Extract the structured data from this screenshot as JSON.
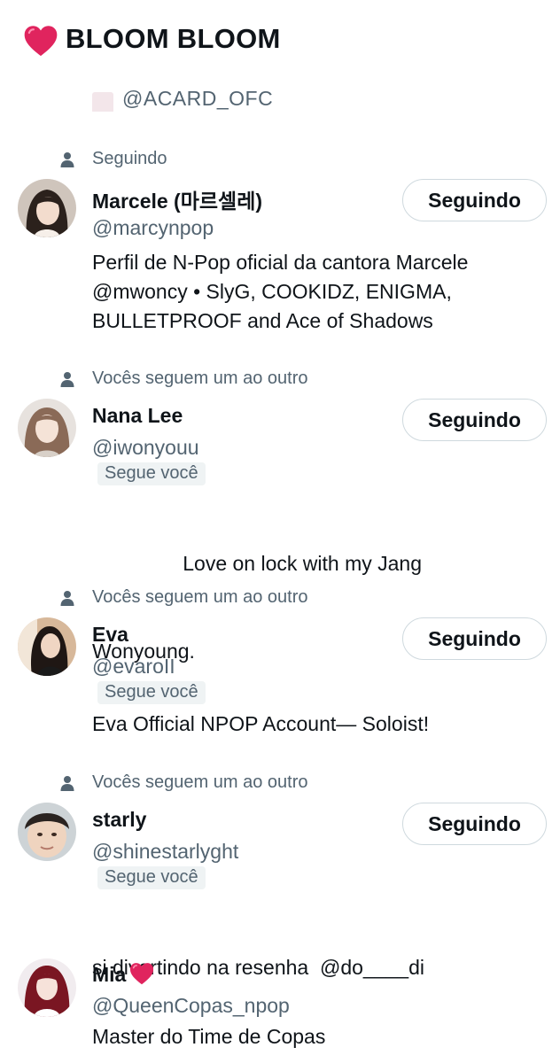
{
  "header": {
    "title": "BLOOM BLOOM",
    "icon": "heart-icon",
    "heart_color": "#e0245e"
  },
  "partial_row": {
    "handle_text": "@ACARD_OFC"
  },
  "colors": {
    "text": "#0f1419",
    "secondary": "#536471",
    "border": "#cfd9de",
    "badge_bg": "#eff3f4"
  },
  "users": [
    {
      "context": "Seguindo",
      "name": "Marcele (마르셀레)",
      "handle": "@marcynpop",
      "follows_you": "",
      "bio": [
        "Perfil de N-Pop oficial da cantora Marcele",
        "@mwoncy • SlyG, COOKIDZ, ENIGMA,",
        "BULLETPROOF and Ace of Shadows"
      ],
      "button": "Seguindo"
    },
    {
      "context": "Vocês seguem um ao outro",
      "name": "Nana Lee",
      "handle": "@iwonyouu",
      "follows_you": "Segue você",
      "bio": [
        "                Love on lock with my Jang",
        "Wonyoung."
      ],
      "button": "Seguindo"
    },
    {
      "context": "Vocês seguem um ao outro",
      "name": "Eva",
      "handle": "@evaroII",
      "follows_you": "Segue você",
      "bio": [
        "Eva Official NPOP Account— Soloist!"
      ],
      "button": "Seguindo"
    },
    {
      "context": "Vocês seguem um ao outro",
      "name": "starly",
      "handle": "@shinestarlyght",
      "follows_you": "Segue você",
      "bio": [
        "si divertindo na resenha  @do____di"
      ],
      "button": "Seguindo"
    },
    {
      "context": "",
      "name": "Mia",
      "handle": "@QueenCopas_npop",
      "follows_you": "",
      "bio": [
        "Master do Time de Copas"
      ],
      "button": ""
    }
  ]
}
